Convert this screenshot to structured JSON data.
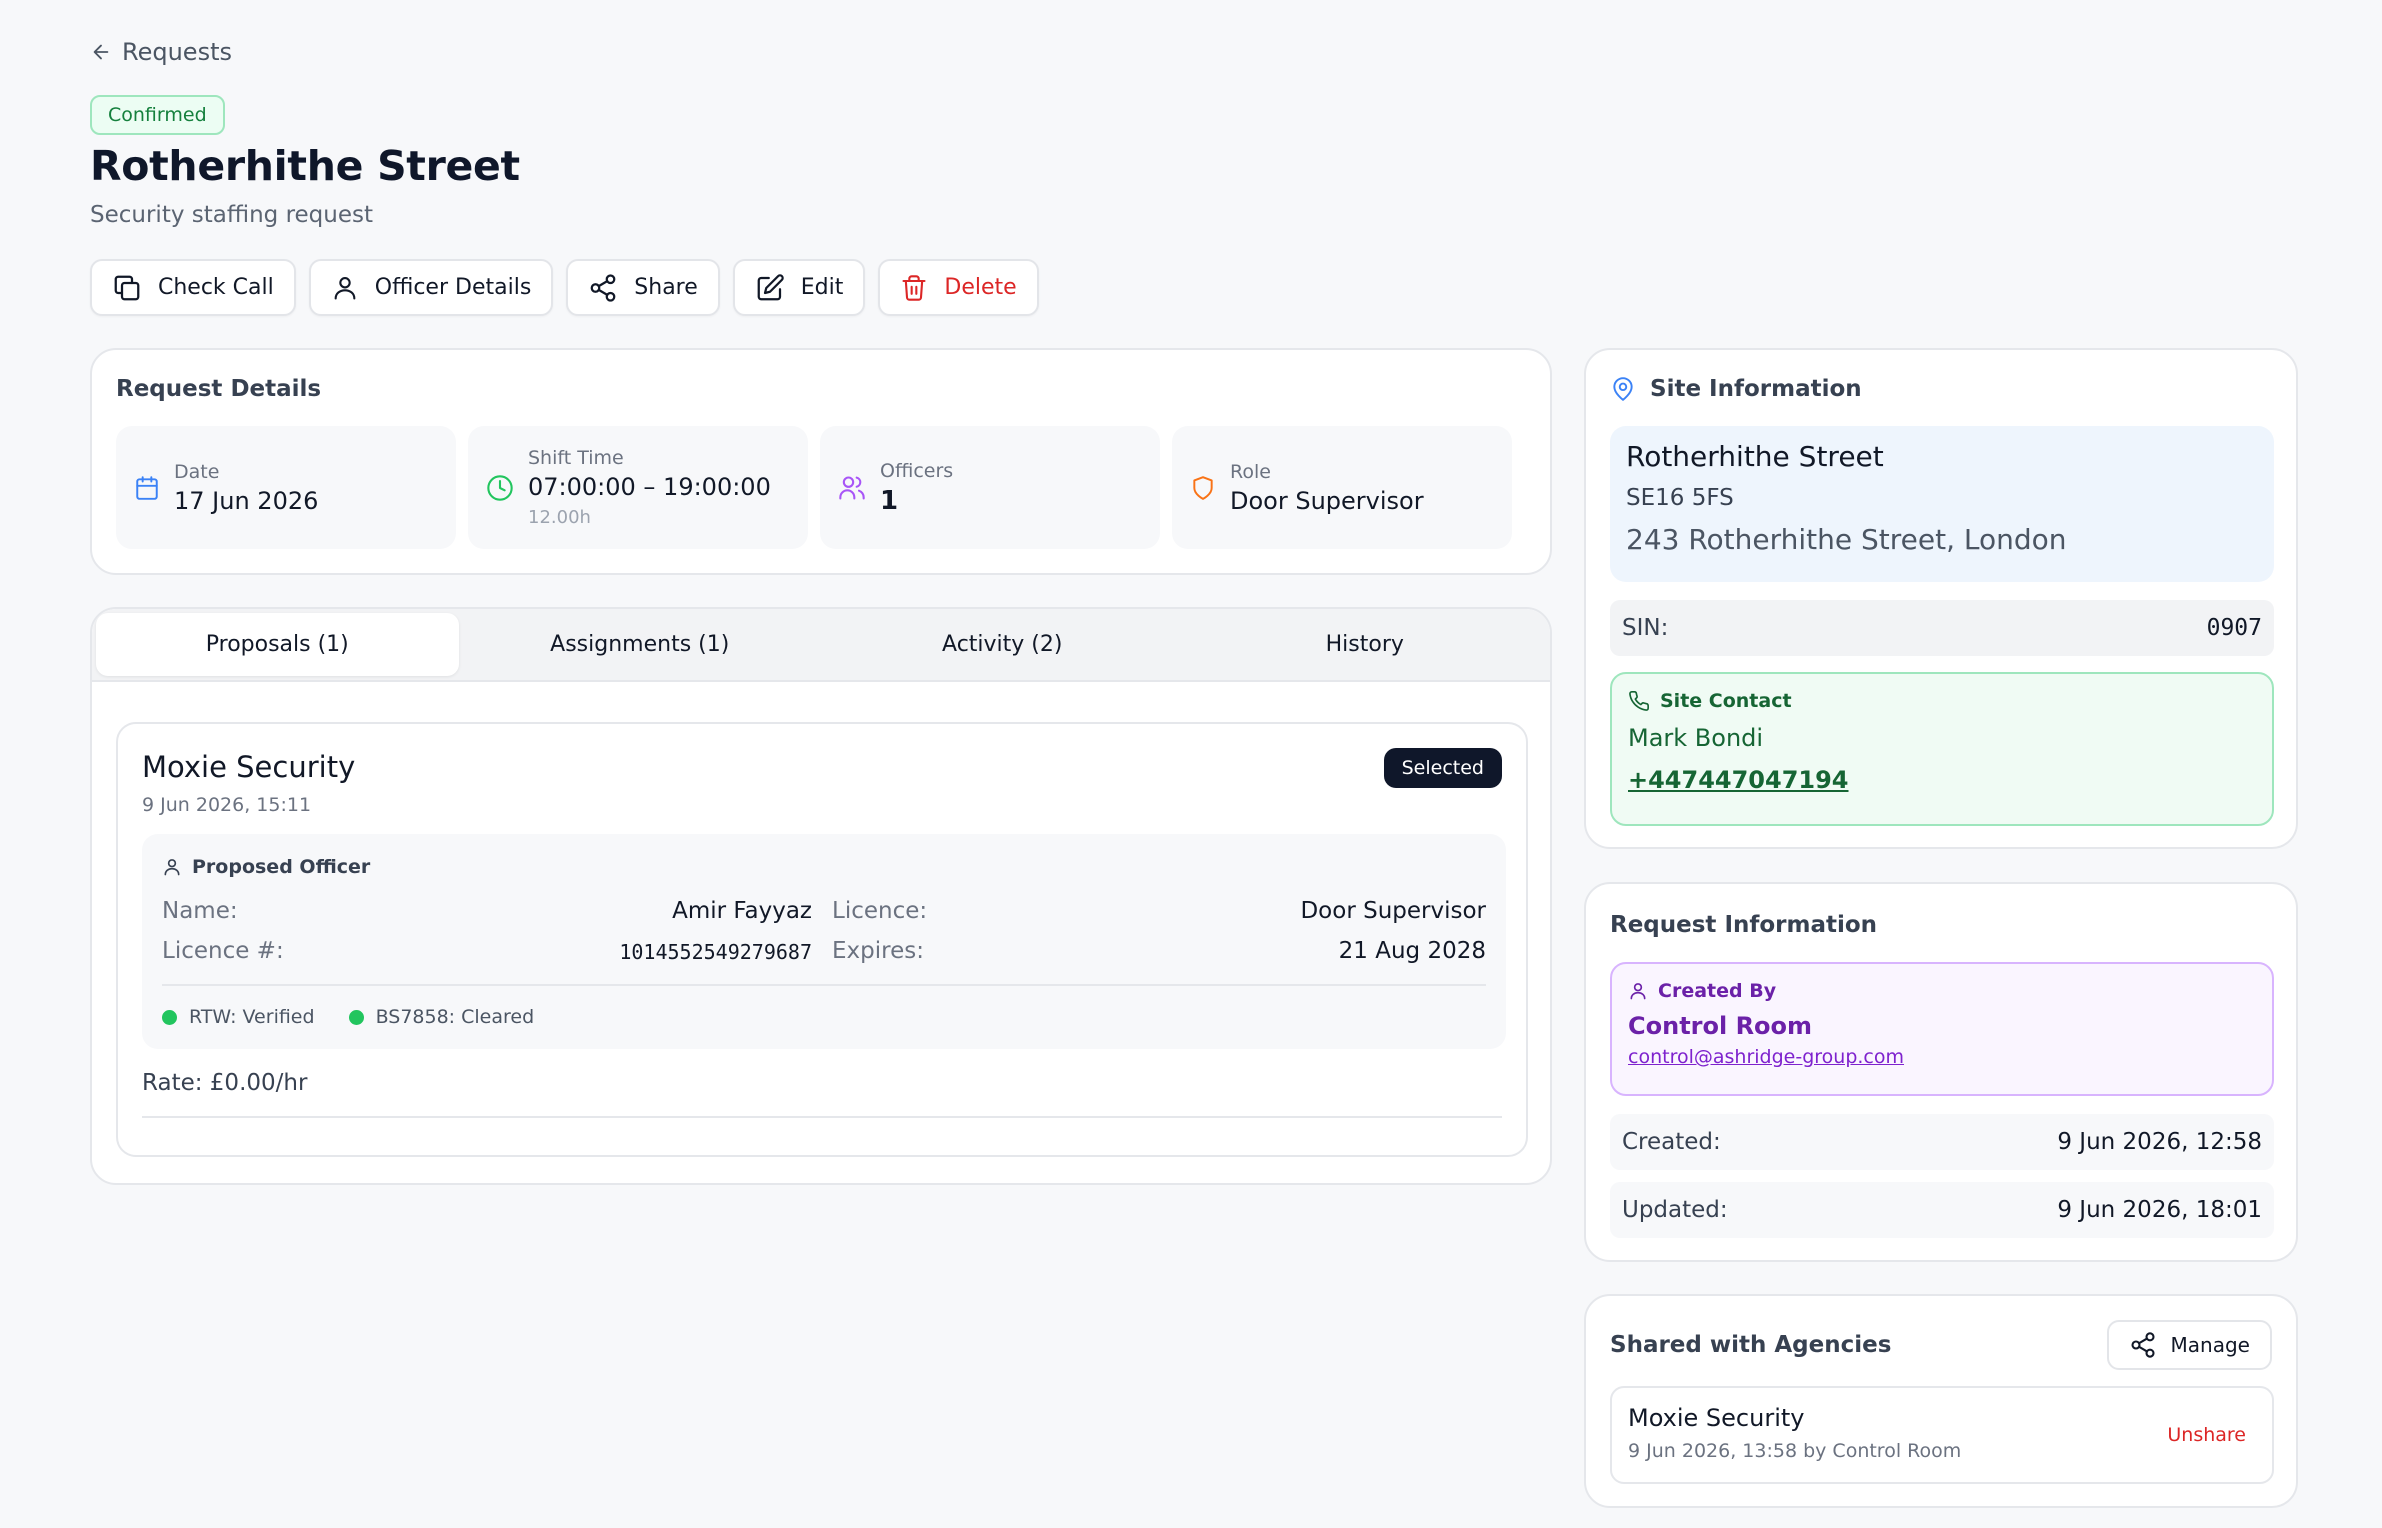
{
  "nav": {
    "back_label": "Requests"
  },
  "status": "Confirmed",
  "title": "Rotherhithe Street",
  "subtitle": "Security staffing request",
  "toolbar": {
    "check_call": "Check Call",
    "officer_details": "Officer Details",
    "share": "Share",
    "edit": "Edit",
    "delete": "Delete"
  },
  "request_details": {
    "title": "Request Details",
    "date_label": "Date",
    "date_value": "17 Jun 2026",
    "shift_label": "Shift Time",
    "shift_value": "07:00:00 – 19:00:00",
    "shift_duration": "12.00h",
    "officers_label": "Officers",
    "officers_value": "1",
    "role_label": "Role",
    "role_value": "Door Supervisor"
  },
  "tabs": [
    {
      "label": "Proposals (1)",
      "active": true
    },
    {
      "label": "Assignments (1)",
      "active": false
    },
    {
      "label": "Activity (2)",
      "active": false
    },
    {
      "label": "History",
      "active": false
    }
  ],
  "proposal": {
    "agency": "Moxie Security",
    "date": "9 Jun 2026, 15:11",
    "badge": "Selected",
    "officer_heading": "Proposed Officer",
    "name_label": "Name:",
    "name_value": "Amir Fayyaz",
    "licence_no_label": "Licence #:",
    "licence_no_value": "1014552549279687",
    "licence_label": "Licence:",
    "licence_value": "Door Supervisor",
    "expires_label": "Expires:",
    "expires_value": "21 Aug 2028",
    "rtw": "RTW: Verified",
    "bs7858": "BS7858: Cleared",
    "rate": "Rate: £0.00/hr"
  },
  "site": {
    "title": "Site Information",
    "name": "Rotherhithe Street",
    "postcode": "SE16 5FS",
    "address": "243 Rotherhithe Street, London",
    "sin_label": "SIN:",
    "sin_value": "0907",
    "contact_heading": "Site Contact",
    "contact_name": "Mark Bondi",
    "contact_phone": "+447447047194"
  },
  "request_info": {
    "title": "Request Information",
    "created_by_heading": "Created By",
    "creator_name": "Control Room",
    "creator_email": "control@ashridge-group.com",
    "created_label": "Created:",
    "created_value": "9 Jun 2026, 12:58",
    "updated_label": "Updated:",
    "updated_value": "9 Jun 2026, 18:01"
  },
  "shared": {
    "title": "Shared with Agencies",
    "manage": "Manage",
    "agency_name": "Moxie Security",
    "agency_meta": "9 Jun 2026, 13:58 by Control Room",
    "unshare": "Unshare"
  },
  "colors": {
    "status_green": "#15803d",
    "danger": "#dc2626",
    "site_blue_bg": "#eef5fd",
    "contact_green": "#166534",
    "creator_purple": "#6b21a8",
    "badge_dark": "#0f172a"
  }
}
